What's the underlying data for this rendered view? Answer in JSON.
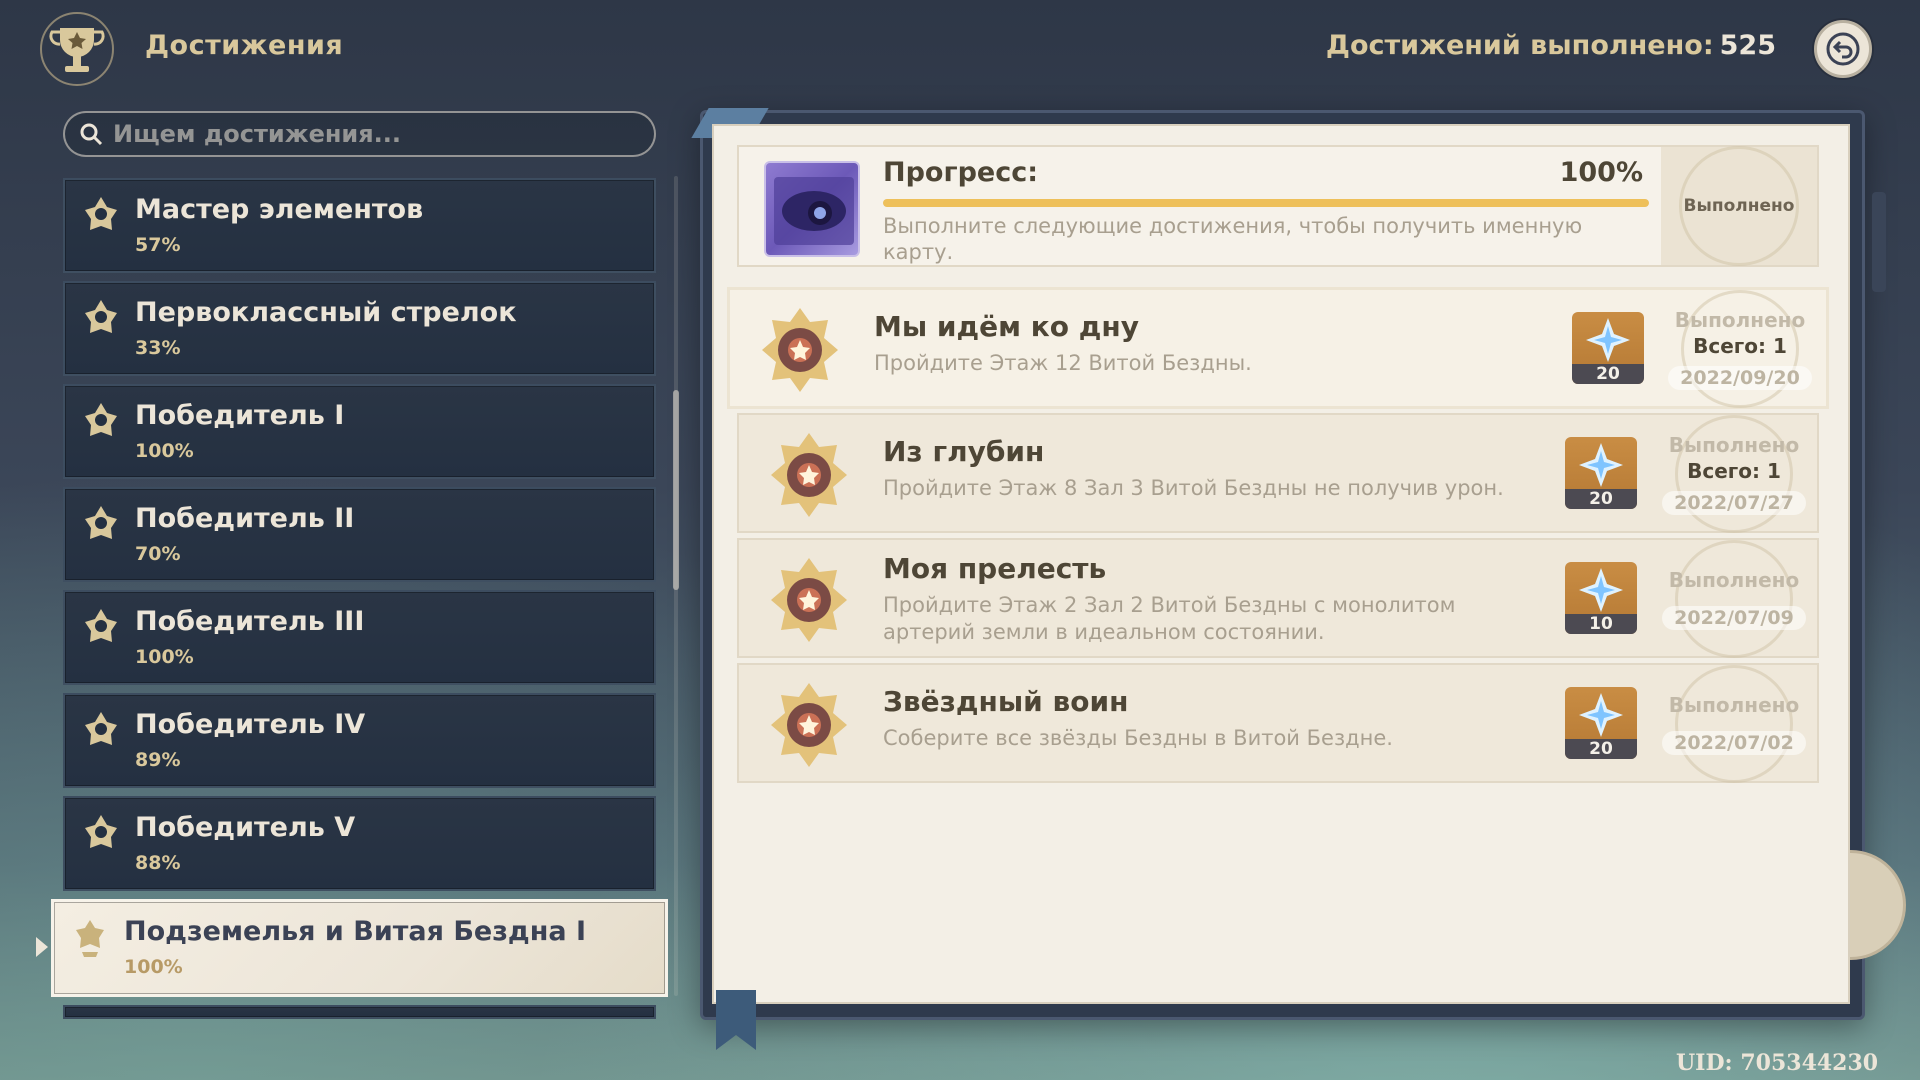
{
  "header": {
    "title": "Достижения",
    "counter_label": "Достижений выполнено:",
    "counter_value": "525",
    "back_icon": "back-arrow-icon"
  },
  "search": {
    "placeholder": "Ищем достижения..."
  },
  "categories": [
    {
      "name": "Мастер элементов",
      "percent": "57%"
    },
    {
      "name": "Первоклассный стрелок",
      "percent": "33%"
    },
    {
      "name": "Победитель I",
      "percent": "100%"
    },
    {
      "name": "Победитель II",
      "percent": "70%"
    },
    {
      "name": "Победитель III",
      "percent": "100%"
    },
    {
      "name": "Победитель IV",
      "percent": "89%"
    },
    {
      "name": "Победитель V",
      "percent": "88%"
    },
    {
      "name": "Подземелья и Витая Бездна I",
      "percent": "100%",
      "selected": true
    }
  ],
  "progress": {
    "label": "Прогресс:",
    "percent_text": "100%",
    "fill": 1.0,
    "description": "Выполните следующие достижения, чтобы получить именную карту.",
    "status": "Выполнено"
  },
  "achievements": [
    {
      "title": "Мы идём ко дну",
      "description": "Пройдите Этаж 12 Витой Бездны.",
      "reward_qty": "20",
      "status": "Выполнено",
      "total": "Всего: 1",
      "date": "2022/09/20"
    },
    {
      "title": "Из глубин",
      "description": "Пройдите Этаж 8 Зал 3 Витой Бездны не получив урон.",
      "reward_qty": "20",
      "status": "Выполнено",
      "total": "Всего: 1",
      "date": "2022/07/27"
    },
    {
      "title": "Моя прелесть",
      "description": "Пройдите Этаж 2 Зал 2 Витой Бездны с монолитом артерий земли в идеальном состоянии.",
      "reward_qty": "10",
      "status": "Выполнено",
      "date": "2022/07/09"
    },
    {
      "title": "Звёздный воин",
      "description": "Соберите все звёзды Бездны в Витой Бездне.",
      "reward_qty": "20",
      "status": "Выполнено",
      "date": "2022/07/02"
    }
  ],
  "footer": {
    "uid": "UID: 705344230"
  },
  "colors": {
    "accent_gold": "#d9c89c",
    "panel_dark": "#243041",
    "page_cream": "#f3efe6",
    "progress_fill": "#eec05a",
    "reward_bg": "#c98d44"
  }
}
